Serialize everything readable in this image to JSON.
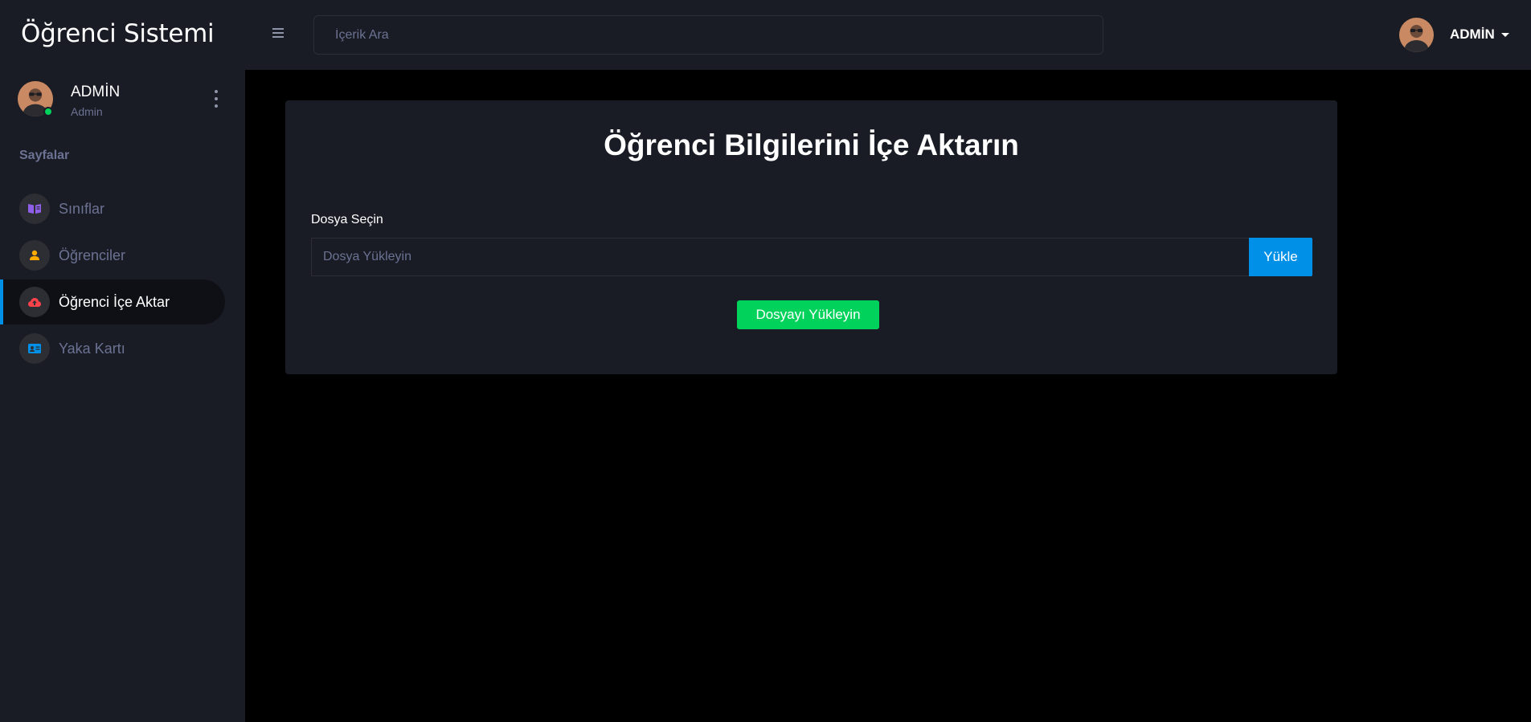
{
  "app": {
    "brand": "Öğrenci Sistemi"
  },
  "header": {
    "search_placeholder": "İçerik Ara",
    "user_name": "ADMİN"
  },
  "sidebar": {
    "profile": {
      "name": "ADMİN",
      "role": "Admin",
      "status": "online"
    },
    "section_title": "Sayfalar",
    "items": [
      {
        "label": "Sınıflar",
        "icon": "book-open-icon",
        "icon_color": "#8f5fe8",
        "active": false
      },
      {
        "label": "Öğrenciler",
        "icon": "user-icon",
        "icon_color": "#ffab00",
        "active": false
      },
      {
        "label": "Öğrenci İçe Aktar",
        "icon": "cloud-upload-icon",
        "icon_color": "#fc424a",
        "active": true
      },
      {
        "label": "Yaka Kartı",
        "icon": "id-card-icon",
        "icon_color": "#0090e7",
        "active": false
      }
    ]
  },
  "main": {
    "title": "Öğrenci Bilgilerini İçe Aktarın",
    "file_label": "Dosya Seçin",
    "file_placeholder": "Dosya Yükleyin",
    "browse_button": "Yükle",
    "submit_button": "Dosyayı Yükleyin"
  },
  "colors": {
    "background": "#000000",
    "panel": "#191c24",
    "primary": "#0090e7",
    "success": "#00d25b",
    "muted": "#6c7293"
  }
}
